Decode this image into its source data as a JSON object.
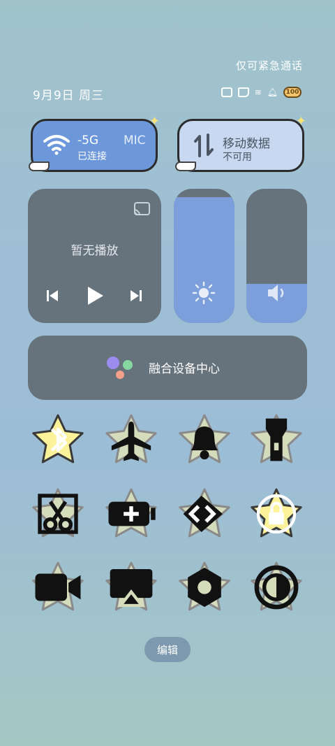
{
  "status": {
    "emergency_note": "仅可紧急通话",
    "date": "9月9日 周三",
    "battery": "100"
  },
  "connectivity": {
    "wifi": {
      "name": "-5G",
      "name_extra": "MIC",
      "status": "已连接"
    },
    "mobile_data": {
      "name": "移动数据",
      "status": "不可用"
    }
  },
  "media": {
    "status": "暂无播放"
  },
  "sliders": {
    "brightness_level": 0.94,
    "volume_level": 0.29
  },
  "device_hub": {
    "label": "融合设备中心"
  },
  "toggles": [
    {
      "icon": "bluetooth-icon",
      "active": true
    },
    {
      "icon": "airplane-icon",
      "active": false
    },
    {
      "icon": "bell-icon",
      "active": false
    },
    {
      "icon": "flashlight-icon",
      "active": false
    },
    {
      "icon": "screenshot-icon",
      "active": false
    },
    {
      "icon": "battery-saver-icon",
      "active": false
    },
    {
      "icon": "share-icon",
      "active": false
    },
    {
      "icon": "rotation-lock-icon",
      "active": true
    },
    {
      "icon": "video-icon",
      "active": false
    },
    {
      "icon": "screen-cast-icon",
      "active": false
    },
    {
      "icon": "settings-icon",
      "active": false
    },
    {
      "icon": "dark-mode-icon",
      "active": false
    }
  ],
  "footer": {
    "edit_label": "编辑"
  },
  "colors": {
    "star_inactive": "#d5dcbc",
    "star_active": "#fbf29a",
    "accent": "#7c9fdc"
  }
}
